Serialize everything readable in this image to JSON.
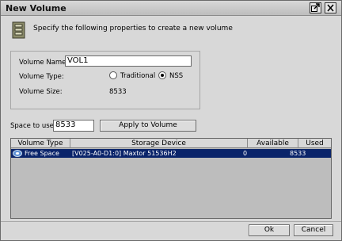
{
  "window": {
    "title": "New Volume"
  },
  "header": {
    "description": "Specify the following properties to create a new volume"
  },
  "form": {
    "name_label": "Volume Name:",
    "name_value": "VOL1",
    "type_label": "Volume Type:",
    "type_options": [
      "Traditional",
      "NSS"
    ],
    "type_selected": "NSS",
    "size_label": "Volume Size:",
    "size_value": "8533"
  },
  "space": {
    "label": "Space to use:",
    "value": "8533",
    "apply_label": "Apply to Volume"
  },
  "table": {
    "columns": [
      "Volume Type",
      "Storage Device",
      "Available",
      "Used"
    ],
    "rows": [
      {
        "volume_type": "Free Space",
        "device": "[V025-A0-D1:0] Maxtor 51536H2",
        "available": "0",
        "used": "8533",
        "selected": true
      }
    ]
  },
  "buttons": {
    "ok": "Ok",
    "cancel": "Cancel"
  },
  "icons": {
    "maximize": "maximize-icon",
    "close": "close-icon",
    "volume": "volume-icon",
    "free_space": "free-space-icon"
  }
}
